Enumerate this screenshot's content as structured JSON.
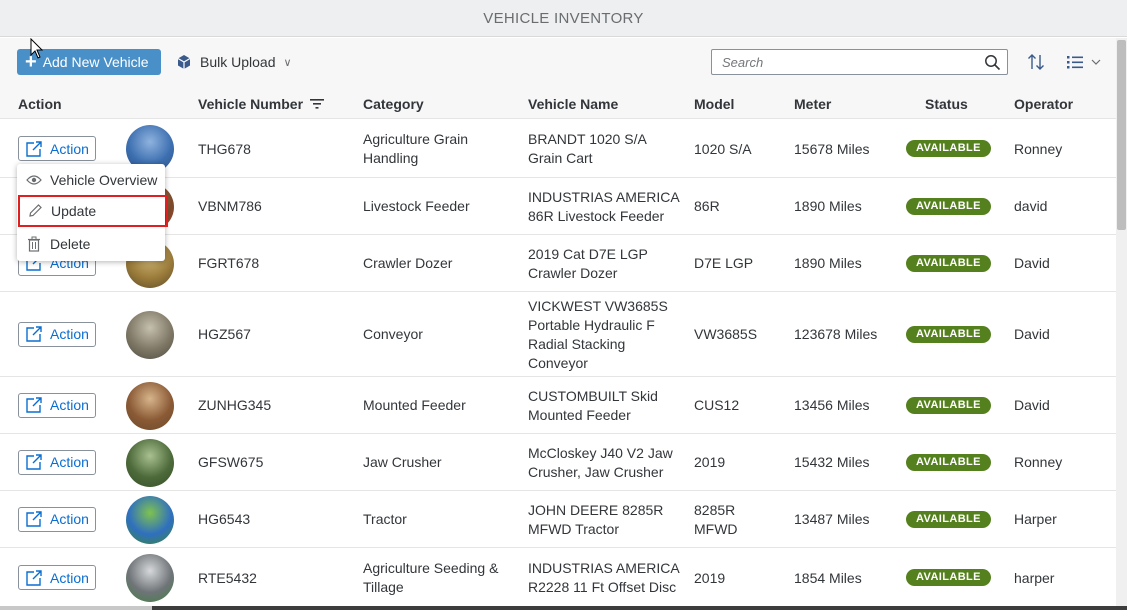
{
  "app_title": "VEHICLE INVENTORY",
  "toolbar": {
    "add_label": "Add New Vehicle",
    "bulk_label": "Bulk Upload",
    "search_placeholder": "Search"
  },
  "columns": [
    "Action",
    "Vehicle Number",
    "Category",
    "Vehicle Name",
    "Model",
    "Meter",
    "Status",
    "Operator"
  ],
  "action_label": "Action",
  "rows": [
    {
      "number": "THG678",
      "category": [
        "Agriculture Grain",
        "Handling"
      ],
      "name": [
        "BRANDT 1020 S/A",
        "Grain Cart"
      ],
      "model": [
        "1020 S/A"
      ],
      "meter": "15678 Miles",
      "status": "AVAILABLE",
      "operator": "Ronney"
    },
    {
      "number": "VBNM786",
      "category": [
        "Livestock Feeder"
      ],
      "name": [
        "INDUSTRIAS AMERICA",
        "86R Livestock Feeder"
      ],
      "model": [
        "86R"
      ],
      "meter": "1890 Miles",
      "status": "AVAILABLE",
      "operator": "david"
    },
    {
      "number": "FGRT678",
      "category": [
        "Crawler Dozer"
      ],
      "name": [
        "2019 Cat D7E LGP",
        "Crawler Dozer"
      ],
      "model": [
        "D7E LGP"
      ],
      "meter": "1890 Miles",
      "status": "AVAILABLE",
      "operator": "David"
    },
    {
      "number": "HGZ567",
      "category": [
        "Conveyor"
      ],
      "name": [
        "VICKWEST VW3685S",
        "Portable Hydraulic F",
        "Radial Stacking",
        "Conveyor"
      ],
      "model": [
        "VW3685S"
      ],
      "meter": "123678 Miles",
      "status": "AVAILABLE",
      "operator": "David"
    },
    {
      "number": "ZUNHG345",
      "category": [
        "Mounted Feeder"
      ],
      "name": [
        "CUSTOMBUILT Skid",
        "Mounted Feeder"
      ],
      "model": [
        "CUS12"
      ],
      "meter": "13456 Miles",
      "status": "AVAILABLE",
      "operator": "David"
    },
    {
      "number": "GFSW675",
      "category": [
        "Jaw Crusher"
      ],
      "name": [
        "McCloskey J40 V2 Jaw",
        "Crusher, Jaw Crusher"
      ],
      "model": [
        "2019"
      ],
      "meter": "15432 Miles",
      "status": "AVAILABLE",
      "operator": "Ronney"
    },
    {
      "number": "HG6543",
      "category": [
        "Tractor"
      ],
      "name": [
        "JOHN DEERE 8285R",
        "MFWD Tractor"
      ],
      "model": [
        "8285R",
        "MFWD"
      ],
      "meter": "13487 Miles",
      "status": "AVAILABLE",
      "operator": "Harper"
    },
    {
      "number": "RTE5432",
      "category": [
        "Agriculture Seeding &",
        "Tillage"
      ],
      "name": [
        "INDUSTRIAS AMERICA",
        "R2228 11 Ft Offset Disc"
      ],
      "model": [
        "2019"
      ],
      "meter": "1854 Miles",
      "status": "AVAILABLE",
      "operator": "harper"
    }
  ],
  "menu": {
    "overview_label": "Vehicle Overview",
    "update_label": "Update",
    "delete_label": "Delete"
  },
  "colors": {
    "accent": "#0a6ed1",
    "button": "#4a90c8",
    "status_available": "#55801e"
  },
  "icons": [
    "plus-icon",
    "cube-icon",
    "search-icon",
    "sort-icon",
    "list-icon",
    "filter-icon",
    "action-icon",
    "eye-icon",
    "pencil-icon",
    "trash-icon"
  ]
}
